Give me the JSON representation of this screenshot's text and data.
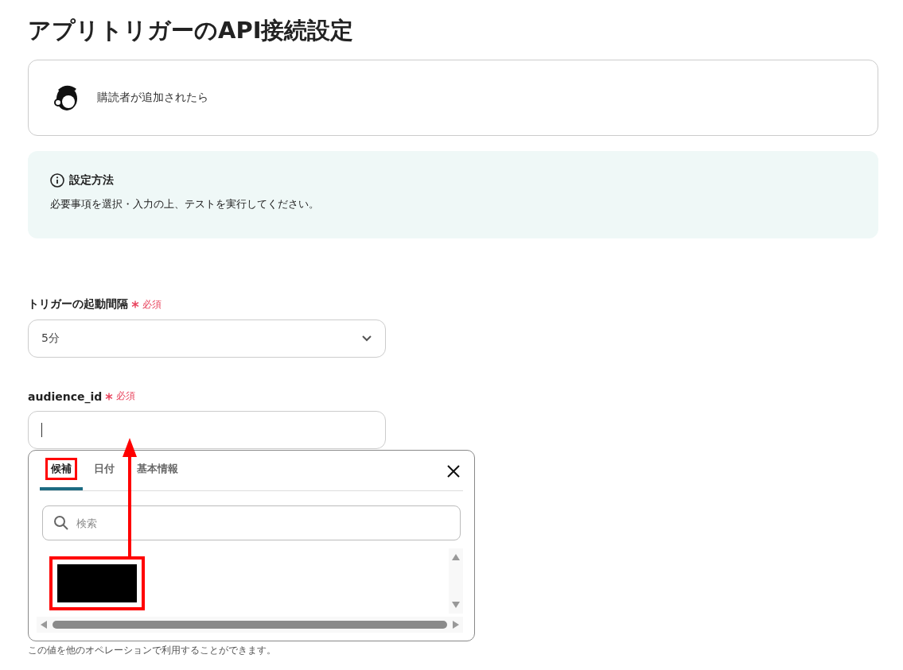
{
  "title": "アプリトリガーのAPI接続設定",
  "trigger": {
    "label": "購読者が追加されたら"
  },
  "info": {
    "heading": "設定方法",
    "text": "必要事項を選択・入力の上、テストを実行してください。"
  },
  "fields": [
    {
      "kind": "select",
      "label": "トリガーの起動間隔",
      "required": "必須",
      "value": "5分"
    },
    {
      "kind": "text",
      "label": "audience_id",
      "required": "必須",
      "focused": true
    }
  ],
  "popup": {
    "tabs": [
      {
        "label": "候補",
        "selected": true,
        "highlighted": true
      },
      {
        "label": "日付",
        "selected": false,
        "highlighted": false
      },
      {
        "label": "基本情報",
        "selected": false,
        "highlighted": false
      }
    ],
    "search": {
      "placeholder": "検索"
    },
    "items": [
      {
        "kind": "redacted",
        "highlighted": true
      }
    ],
    "annotations": [
      {
        "kind": "arrow"
      }
    ]
  },
  "hint": "この値を他のオペレーションで利用することができます。"
}
